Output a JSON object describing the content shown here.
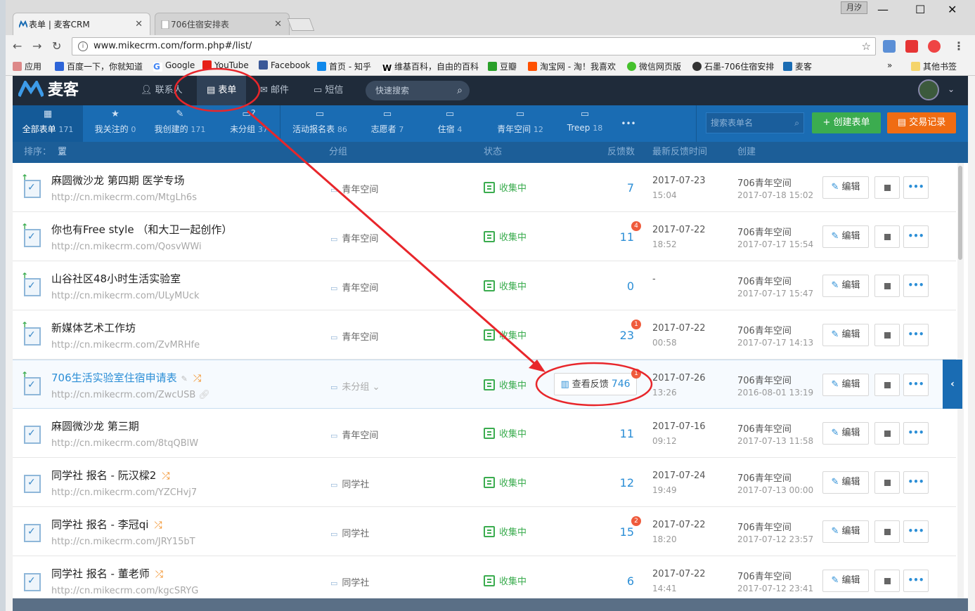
{
  "browser": {
    "tabs": [
      {
        "label": "表单 | 麦客CRM",
        "active": true
      },
      {
        "label": "706住宿安排表",
        "active": false
      }
    ],
    "user_label": "月汐",
    "url": "www.mikecrm.com/form.php#/list/",
    "bookmarks": [
      {
        "label": "应用",
        "icon": "apps-icon"
      },
      {
        "label": "百度一下，你就知道",
        "icon": "baidu-icon"
      },
      {
        "label": "Google",
        "icon": "google-icon"
      },
      {
        "label": "YouTube",
        "icon": "youtube-icon"
      },
      {
        "label": "Facebook",
        "icon": "facebook-icon"
      },
      {
        "label": "首页 - 知乎",
        "icon": "zhihu-icon"
      },
      {
        "label": "维基百科，自由的百科",
        "icon": "wikipedia-icon"
      },
      {
        "label": "豆瓣",
        "icon": "douban-icon"
      },
      {
        "label": "淘宝网 - 淘！我喜欢",
        "icon": "taobao-icon"
      },
      {
        "label": "微信网页版",
        "icon": "wechat-icon"
      },
      {
        "label": "石墨-706住宿安排",
        "icon": "shimo-icon"
      },
      {
        "label": "麦客",
        "icon": "mikecrm-icon"
      }
    ],
    "bookmarks_more": "»",
    "other_bookmarks": "其他书签"
  },
  "app": {
    "brand": "麦客",
    "nav": [
      {
        "label": "联系人",
        "icon": "contacts-icon"
      },
      {
        "label": "表单",
        "icon": "form-icon",
        "active": true
      },
      {
        "label": "邮件",
        "icon": "mail-icon"
      },
      {
        "label": "短信",
        "icon": "sms-icon"
      }
    ],
    "quick_search": "快速搜索"
  },
  "categories": [
    {
      "label": "全部表单",
      "count": "171",
      "icon": "grid-icon",
      "active": true
    },
    {
      "label": "我关注的",
      "count": "0",
      "icon": "star-icon"
    },
    {
      "label": "我创建的",
      "count": "171",
      "icon": "pencil-icon"
    },
    {
      "label": "未分组",
      "count": "37",
      "icon": "folder-question-icon"
    },
    {
      "label": "活动报名表",
      "count": "86",
      "icon": "folder-icon"
    },
    {
      "label": "志愿者",
      "count": "7",
      "icon": "folder-icon"
    },
    {
      "label": "住宿",
      "count": "4",
      "icon": "folder-icon"
    },
    {
      "label": "青年空间",
      "count": "12",
      "icon": "folder-icon"
    },
    {
      "label": "Treep",
      "count": "18",
      "icon": "folder-icon"
    }
  ],
  "more_categories": "•••",
  "search_forms_placeholder": "搜索表单名",
  "create_form": "创建表单",
  "trade_records": "交易记录",
  "columns": {
    "sort_label": "排序：",
    "sort_value": "置顶优先",
    "group": "分组",
    "status": "状态",
    "feedback": "反馈数",
    "latest": "最新反馈时间",
    "created": "创建"
  },
  "action_labels": {
    "edit": "编辑",
    "more": "•••",
    "view_feedback": "查看反馈"
  },
  "rows": [
    {
      "title": "麻圆微沙龙 第四期 医学专场",
      "url": "http://cn.mikecrm.com/MtgLh6s",
      "group": "青年空间",
      "status": "收集中",
      "feedback": "7",
      "badge": "",
      "date": "2017-07-23",
      "time": "15:04",
      "creator": "706青年空间",
      "created": "2017-07-18 15:02",
      "pinned": true
    },
    {
      "title": "你也有Free style （和大卫一起创作）",
      "url": "http://cn.mikecrm.com/QosvWWi",
      "group": "青年空间",
      "status": "收集中",
      "feedback": "11",
      "badge": "4",
      "date": "2017-07-22",
      "time": "18:52",
      "creator": "706青年空间",
      "created": "2017-07-17 15:54",
      "pinned": true
    },
    {
      "title": "山谷社区48小时生活实验室",
      "url": "http://cn.mikecrm.com/ULyMUck",
      "group": "青年空间",
      "status": "收集中",
      "feedback": "0",
      "badge": "",
      "date": "-",
      "time": "",
      "creator": "706青年空间",
      "created": "2017-07-17 15:47",
      "pinned": true
    },
    {
      "title": "新媒体艺术工作坊",
      "url": "http://cn.mikecrm.com/ZvMRHfe",
      "group": "青年空间",
      "status": "收集中",
      "feedback": "23",
      "badge": "1",
      "date": "2017-07-22",
      "time": "00:58",
      "creator": "706青年空间",
      "created": "2017-07-17 14:13",
      "pinned": true
    },
    {
      "title": "706生活实验室住宿申请表",
      "url": "http://cn.mikecrm.com/ZwcUSB",
      "group": "未分组",
      "status": "收集中",
      "feedback": "746",
      "badge": "1",
      "date": "2017-07-26",
      "time": "13:26",
      "creator": "706青年空间",
      "created": "2016-08-01 13:19",
      "pinned": true
    },
    {
      "title": "麻圆微沙龙 第三期",
      "url": "http://cn.mikecrm.com/8tqQBlW",
      "group": "青年空间",
      "status": "收集中",
      "feedback": "11",
      "badge": "",
      "date": "2017-07-16",
      "time": "09:12",
      "creator": "706青年空间",
      "created": "2017-07-13 11:58",
      "pinned": false
    },
    {
      "title": "同学社 报名 - 阮汉樑2",
      "url": "http://cn.mikecrm.com/YZCHvj7",
      "group": "同学社",
      "status": "收集中",
      "feedback": "12",
      "badge": "",
      "date": "2017-07-24",
      "time": "19:49",
      "creator": "706青年空间",
      "created": "2017-07-13 00:00",
      "pinned": false
    },
    {
      "title": "同学社 报名 - 李冠qi",
      "url": "http://cn.mikecrm.com/JRY15bT",
      "group": "同学社",
      "status": "收集中",
      "feedback": "15",
      "badge": "2",
      "date": "2017-07-22",
      "time": "18:20",
      "creator": "706青年空间",
      "created": "2017-07-12 23:57",
      "pinned": false
    },
    {
      "title": "同学社 报名 - 董老师",
      "url": "http://cn.mikecrm.com/kgcSRYG",
      "group": "同学社",
      "status": "收集中",
      "feedback": "6",
      "badge": "",
      "date": "2017-07-22",
      "time": "14:41",
      "creator": "706青年空间",
      "created": "2017-07-12 23:41",
      "pinned": false
    }
  ],
  "colors": {
    "accent": "#1a6cb3",
    "green": "#3bac4f",
    "orange": "#f06c12",
    "annotation": "#e8262b"
  }
}
